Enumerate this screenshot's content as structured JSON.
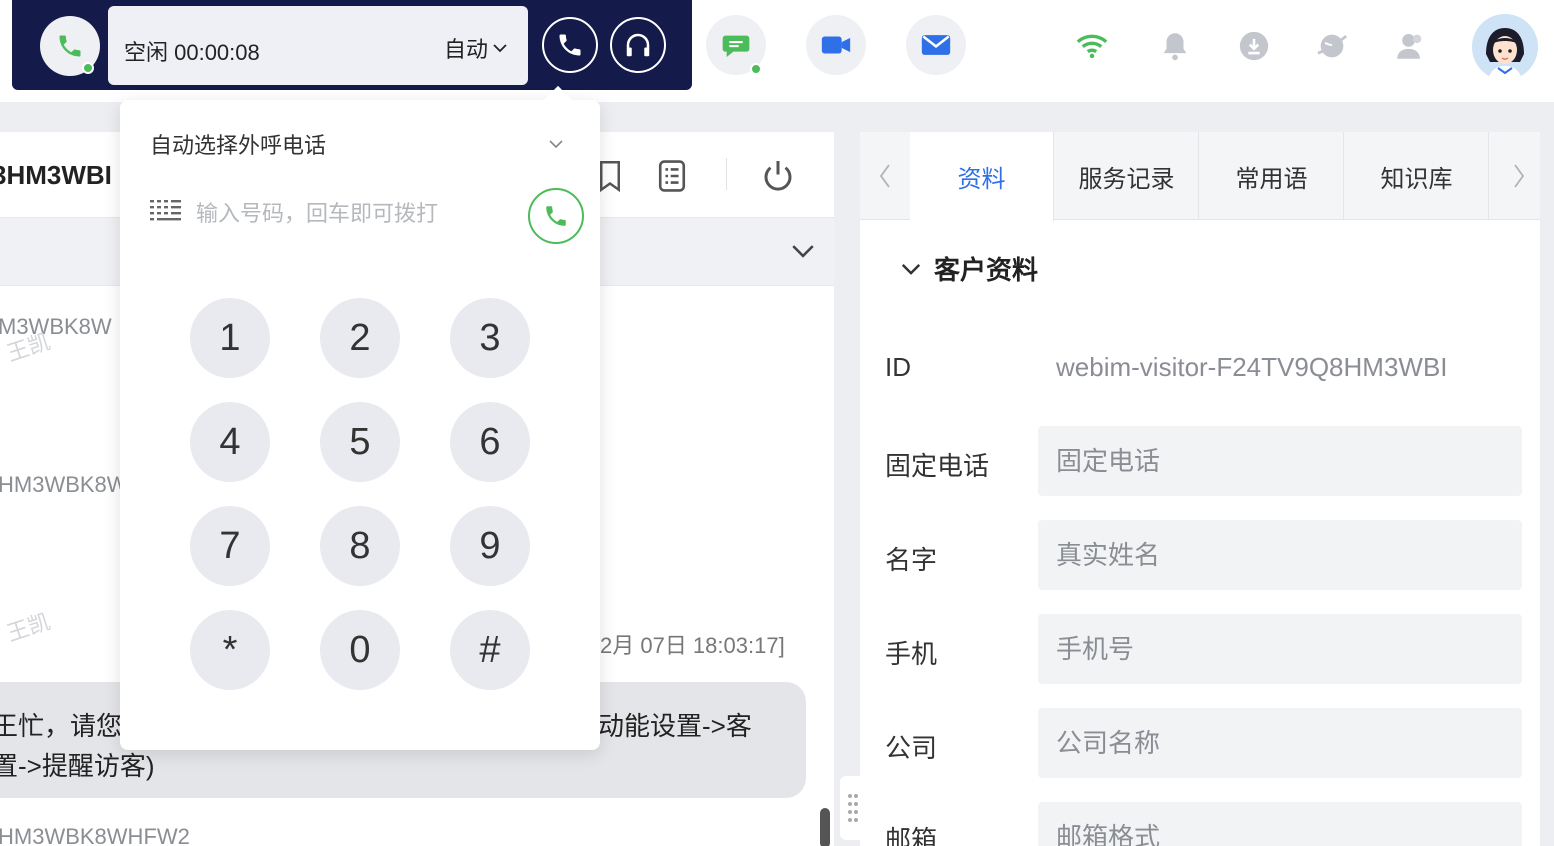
{
  "topbar": {
    "status": "空闲 00:00:08",
    "mode": "自动",
    "icons": [
      "phone-icon",
      "headset-icon",
      "chat-icon",
      "video-icon",
      "mail-icon",
      "wifi-icon",
      "bell-icon",
      "download-icon",
      "planet-icon",
      "user-icon"
    ]
  },
  "mid": {
    "title": "3HM3WBI",
    "ids": [
      "M3WBK8W",
      "HM3WBK8W",
      "HM3WBK8WHFW2"
    ],
    "watermark": "王凯",
    "timestamp": "2月 07日 18:03:17]",
    "bubble_line1": "王忙，请您",
    "bubble_line1b": "动能设置->客",
    "bubble_line2": "置->提醒访客)"
  },
  "dialer": {
    "select_label": "自动选择外呼电话",
    "input_placeholder": "输入号码，回车即可拨打",
    "keys": [
      "1",
      "2",
      "3",
      "4",
      "5",
      "6",
      "7",
      "8",
      "9",
      "*",
      "0",
      "#"
    ]
  },
  "right": {
    "tabs": [
      "资料",
      "服务记录",
      "常用语",
      "知识库"
    ],
    "section_title": "客户资料",
    "id_label": "ID",
    "id_value": "webim-visitor-F24TV9Q8HM3WBI",
    "fields": [
      {
        "label": "固定电话",
        "placeholder": "固定电话"
      },
      {
        "label": "名字",
        "placeholder": "真实姓名"
      },
      {
        "label": "手机",
        "placeholder": "手机号"
      },
      {
        "label": "公司",
        "placeholder": "公司名称"
      },
      {
        "label": "邮箱",
        "placeholder": "邮箱格式"
      }
    ]
  },
  "colors": {
    "navy": "#141b4a",
    "green": "#4cbb5a",
    "blue": "#2f6fe8"
  }
}
